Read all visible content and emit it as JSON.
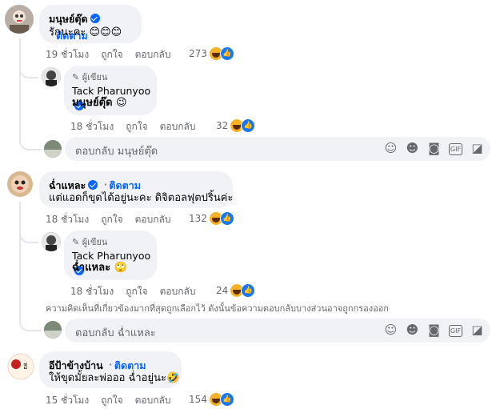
{
  "labels": {
    "follow": "ติดตาม",
    "author": "ผู้เขียน",
    "like": "ถูกใจ",
    "reply": "ตอบกลับ"
  },
  "comments": [
    {
      "name": "มนุษย์ตุ๊ด",
      "text": "รักนะคะ 😊😊😊",
      "time": "19 ชั่วโมง",
      "reactions": "273",
      "reply": {
        "name": "Tack Pharunyoo",
        "text": "มนุษย์ตุ๊ด 😉",
        "time": "18 ชั่วโมง",
        "reactions": "32"
      },
      "reply_placeholder": "ตอบกลับ มนุษย์ตุ๊ด"
    },
    {
      "name": "ฉ่ำแหละ",
      "text": "แต่แอดก็ขุดได้อยู่นะคะ ดิจิตอลฟุตปริ้นค่ะ",
      "time": "18 ชั่วโมง",
      "reactions": "132",
      "reply": {
        "name": "Tack Pharunyoo",
        "text": "ฉ่ำแหละ 🙄",
        "time": "18 ชั่วโมง",
        "reactions": "24"
      },
      "note": "ความคิดเห็นที่เกี่ยวข้องมากที่สุดถูกเลือกไว้ ดังนั้นข้อความตอบกลับบางส่วนอาจถูกกรองออก",
      "reply_placeholder": "ตอบกลับ ฉ่ำแหละ"
    },
    {
      "name": "อีป้าข้างบ้าน",
      "text": "ให้ขุดมั้ยละพ่อออ ฉ่ำอยู่นะ🤣",
      "time": "15 ชั่วโมง",
      "reactions": "154"
    }
  ],
  "icons": [
    "emoji-icon",
    "smile-icon",
    "camera-icon",
    "gif-icon",
    "sticker-icon"
  ],
  "colors": {
    "accent": "#0866ff",
    "bubble": "#f0f2f5",
    "meta": "#65676b"
  }
}
